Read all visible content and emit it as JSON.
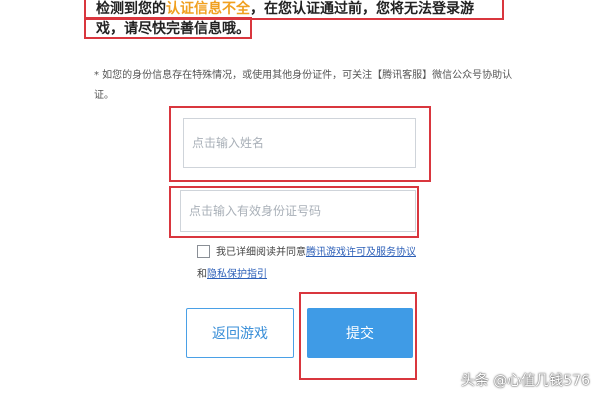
{
  "warning": {
    "line1_prefix": "检测到您的",
    "line1_highlight": "认证信息不全",
    "line1_suffix": "，在您认证通过前，您将无法登录游",
    "line2": "戏，请尽快完善信息哦。"
  },
  "note": "* 如您的身份信息存在特殊情况，或使用其他身份证件，可关注【腾讯客服】微信公众号协助认证。",
  "form": {
    "name_placeholder": "点击输入姓名",
    "id_placeholder": "点击输入有效身份证号码"
  },
  "agreement": {
    "prefix": "我已详细阅读并同意",
    "link1": "腾讯游戏许可及服务协议",
    "and": "和",
    "link2": "隐私保护指引",
    "checked": false
  },
  "buttons": {
    "back": "返回游戏",
    "submit": "提交"
  },
  "watermark": "头条 @心值几钱576",
  "colors": {
    "annotation": "#d9363e",
    "highlight": "#f0a020",
    "primary": "#3f9be6",
    "link": "#2c5fb8"
  }
}
